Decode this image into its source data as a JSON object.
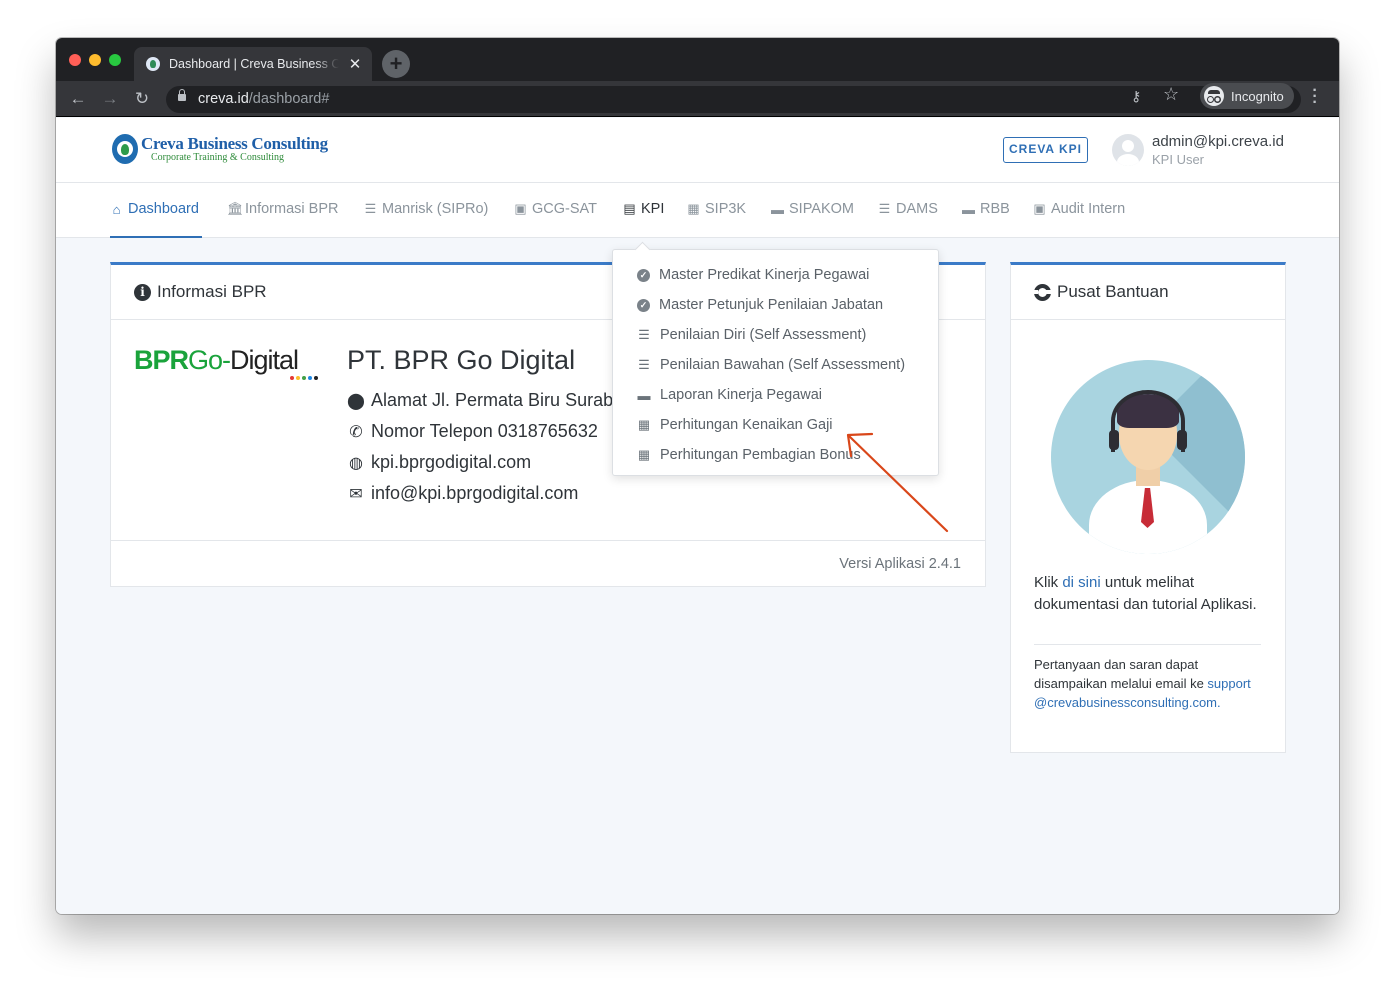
{
  "browser": {
    "tab_title": "Dashboard | Creva Business Consulting",
    "url_domain": "creva.id",
    "url_path": "/dashboard#",
    "profile_label": "Incognito"
  },
  "header": {
    "logo_name": "Creva Business Consulting",
    "logo_tagline": "Corporate Training & Consulting",
    "app_badge": "CREVA KPI",
    "user_email": "admin@kpi.creva.id",
    "user_role": "KPI User"
  },
  "nav": {
    "items": [
      {
        "label": "Dashboard",
        "icon": "home-icon"
      },
      {
        "label": "Informasi BPR",
        "icon": "bank-icon"
      },
      {
        "label": "Manrisk (SIPRo)",
        "icon": "checklist-icon"
      },
      {
        "label": "GCG-SAT",
        "icon": "clipboard-check-icon"
      },
      {
        "label": "KPI",
        "icon": "clipboard-icon"
      },
      {
        "label": "SIP3K",
        "icon": "contact-book-icon"
      },
      {
        "label": "SIPAKOM",
        "icon": "book-icon"
      },
      {
        "label": "DAMS",
        "icon": "checklist-icon"
      },
      {
        "label": "RBB",
        "icon": "book-icon"
      },
      {
        "label": "Audit Intern",
        "icon": "clipboard-check-icon"
      }
    ]
  },
  "kpi_menu": {
    "items": [
      {
        "label": "Master Predikat Kinerja Pegawai",
        "icon": "check-circle-icon"
      },
      {
        "label": "Master Petunjuk Penilaian Jabatan",
        "icon": "check-circle-icon"
      },
      {
        "label": "Penilaian Diri (Self Assessment)",
        "icon": "checklist-icon"
      },
      {
        "label": "Penilaian Bawahan (Self Assessment)",
        "icon": "checklist-icon"
      },
      {
        "label": "Laporan Kinerja Pegawai",
        "icon": "book-icon"
      },
      {
        "label": "Perhitungan Kenaikan Gaji",
        "icon": "calculator-icon"
      },
      {
        "label": "Perhitungan Pembagian Bonus",
        "icon": "calculator-icon"
      }
    ]
  },
  "info_card": {
    "title": "Informasi BPR",
    "bpr_logo_part1": "BPR",
    "bpr_logo_part2": "Go-",
    "bpr_logo_part3": "Digital",
    "company_name": "PT. BPR Go Digital",
    "address": "Alamat Jl. Permata Biru Surab",
    "phone": "Nomor Telepon 0318765632",
    "website": "kpi.bprgodigital.com",
    "email": "info@kpi.bprgodigital.com",
    "version": "Versi Aplikasi 2.4.1"
  },
  "help_card": {
    "title": "Pusat Bantuan",
    "text_before": "Klik ",
    "link_text": "di sini",
    "text_after": " untuk melihat dokumentasi dan tutorial Aplikasi.",
    "contact_text": "Pertanyaan dan saran dapat disampaikan melalui email ke ",
    "contact_email": "support@crevabusinessconsulting.com."
  },
  "colors": {
    "accent": "#2f6fb5",
    "card_top_border": "#3b7bc8",
    "annotation_arrow": "#d9471a",
    "bpr_green": "#1aa33b"
  }
}
